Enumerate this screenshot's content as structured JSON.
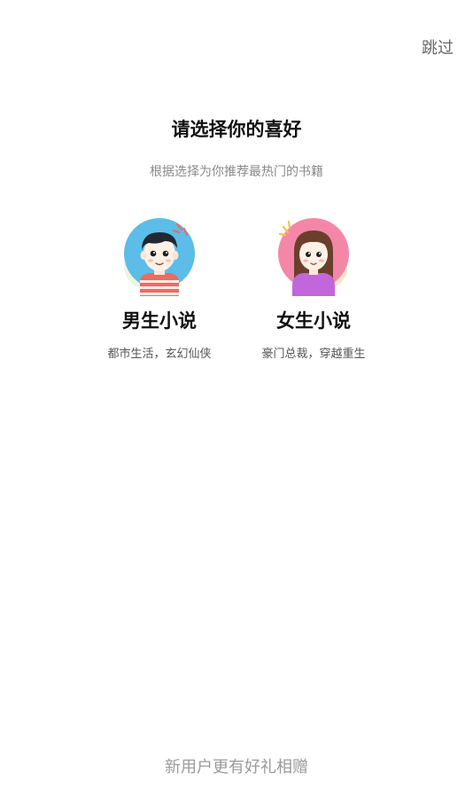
{
  "header": {
    "skip_label": "跳过"
  },
  "main": {
    "title": "请选择你的喜好",
    "subtitle": "根据选择为你推荐最热门的书籍",
    "options": [
      {
        "icon": "boy-avatar-icon",
        "title": "男生小说",
        "desc": "都市生活，玄幻仙侠",
        "circle_color": "#5bbde8"
      },
      {
        "icon": "girl-avatar-icon",
        "title": "女生小说",
        "desc": "豪门总裁，穿越重生",
        "circle_color": "#f487a8"
      }
    ]
  },
  "footer": {
    "promo": "新用户更有好礼相赠"
  },
  "colors": {
    "skip_text": "#666666",
    "title_text": "#111111",
    "subtitle_text": "#8a8a8a",
    "promo_text": "#9a9a9a"
  }
}
